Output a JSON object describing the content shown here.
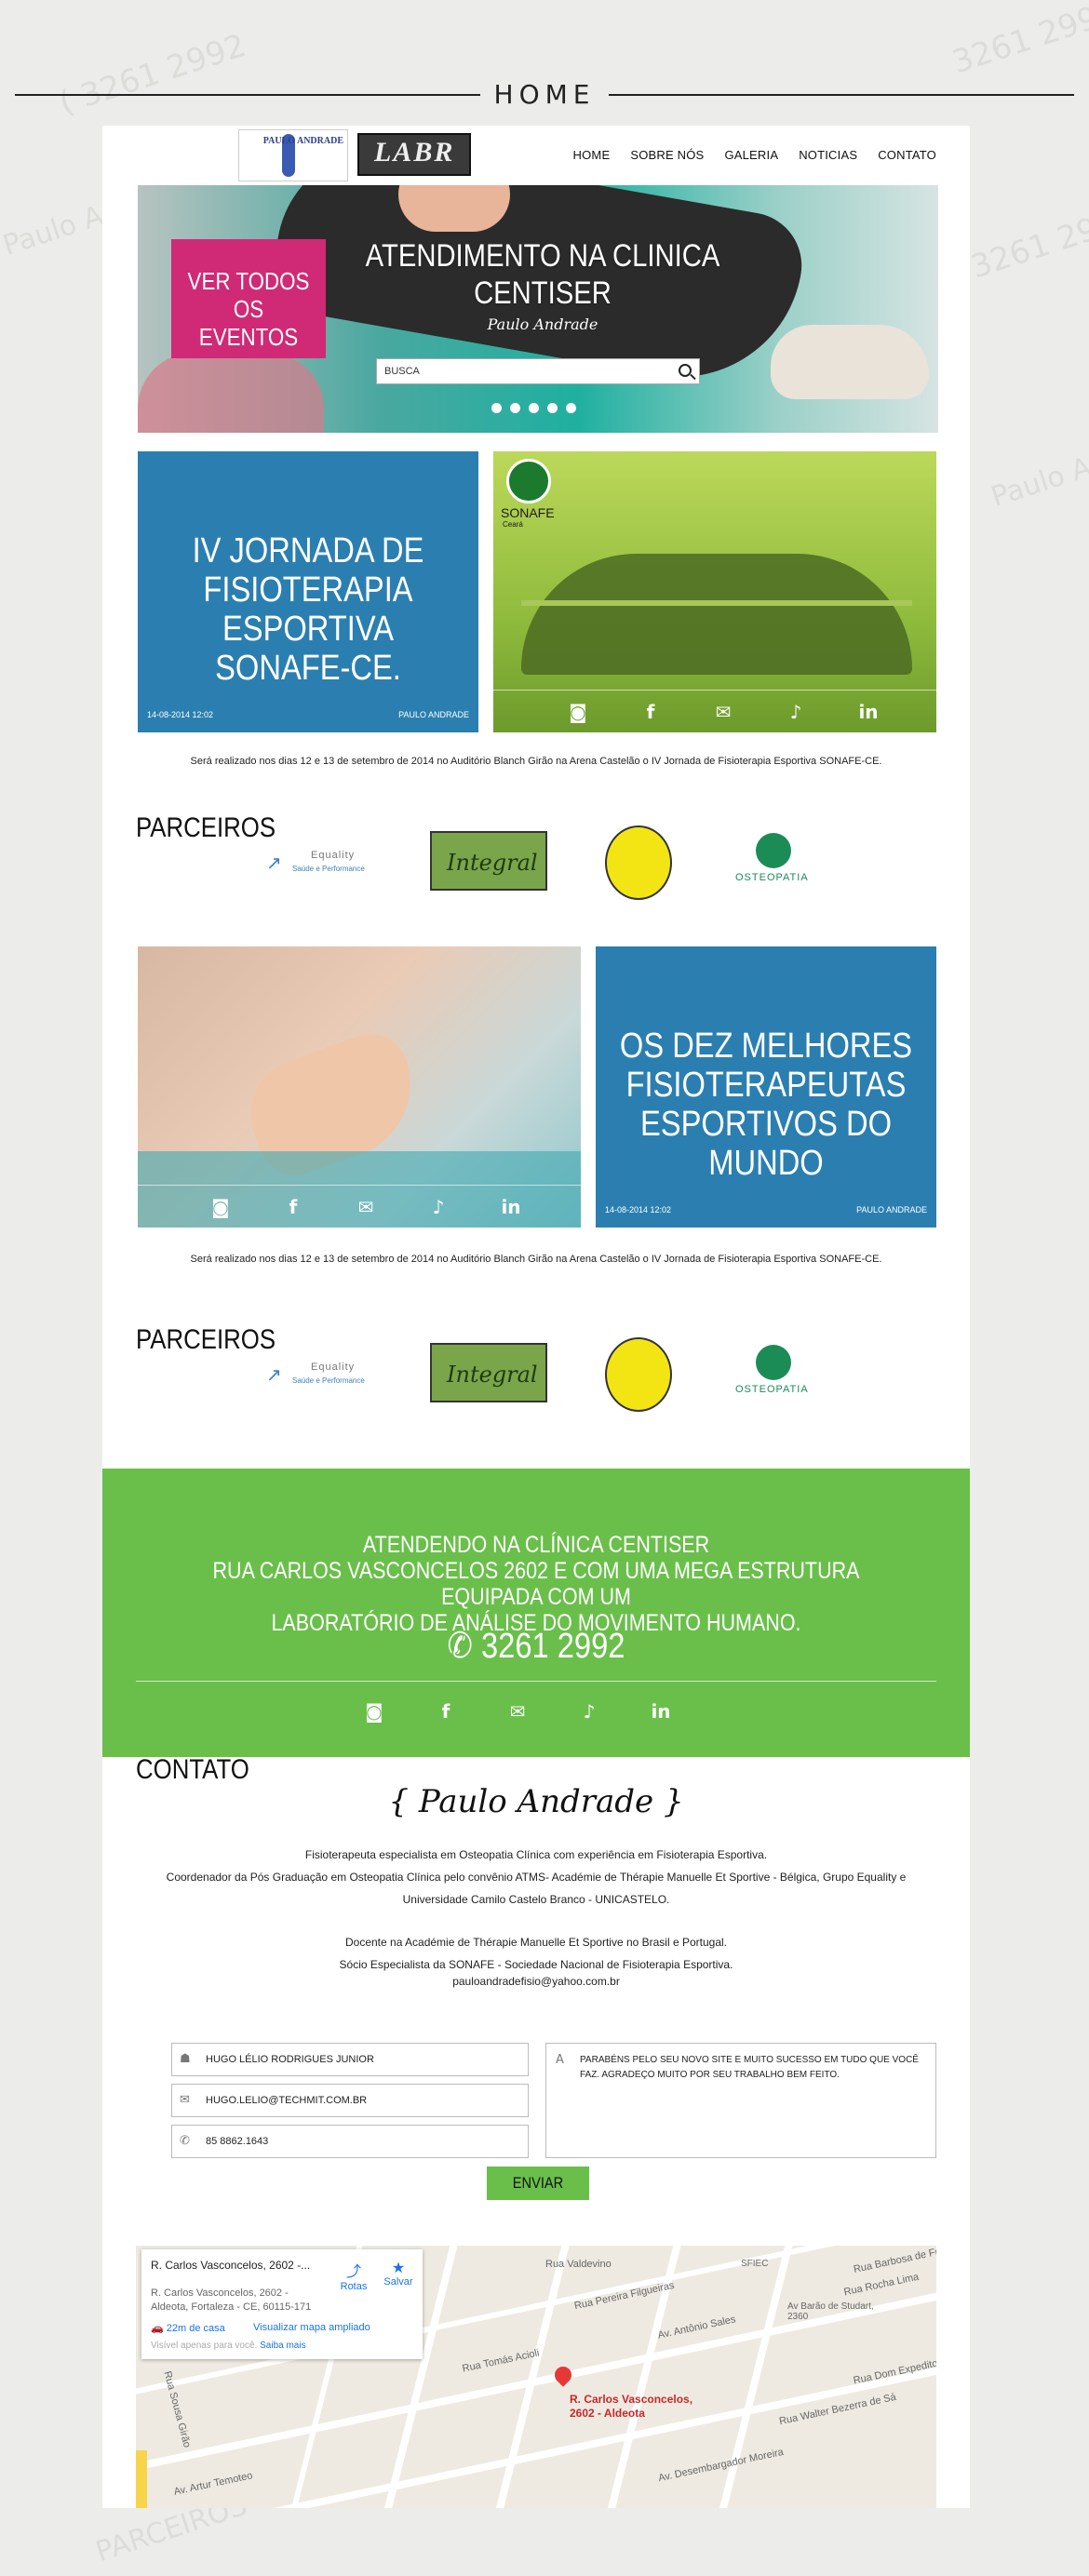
{
  "page_title": "HOME",
  "nav": {
    "items": [
      "HOME",
      "SOBRE NÓS",
      "GALERIA",
      "NOTICIAS",
      "CONTATO"
    ]
  },
  "logos": {
    "paulo": "PAULO ANDRADE",
    "labr": "LABR"
  },
  "hero": {
    "events_button": "VER TODOS OS EVENTOS",
    "title": "ATENDIMENTO NA CLINICA CENTISER",
    "signature": "Paulo Andrade",
    "search_placeholder": "BUSCA",
    "slide_count": 5
  },
  "post1": {
    "title": "IV JORNADA DE FISIOTERAPIA ESPORTIVA SONAFE-CE.",
    "date": "14-08-2014 12:02",
    "author": "PAULO ANDRADE",
    "sonafe_label": "SONAFE",
    "sonafe_sub": "Ceará",
    "caption": "Será realizado nos dias 12 e 13 de setembro de 2014 no Auditório Blanch Girão na Arena Castelão o IV Jornada de Fisioterapia Esportiva SONAFE-CE."
  },
  "post2": {
    "title": "OS DEZ MELHORES FISIOTERAPEUTAS ESPORTIVOS DO MUNDO",
    "date": "14-08-2014 12:02",
    "author": "PAULO ANDRADE",
    "caption": "Será realizado nos dias 12 e 13 de setembro de 2014 no Auditório Blanch Girão na Arena Castelão o IV Jornada de Fisioterapia Esportiva SONAFE-CE."
  },
  "parceiros": {
    "title": "PARCEIROS",
    "equality": "Equality",
    "equality_sub": "Saúde e Performance",
    "integral": "Integral",
    "osteopatia": "OSTEOPATIA"
  },
  "green": {
    "line1": "ATENDENDO NA CLÍNICA CENTISER",
    "line2": "RUA CARLOS VASCONCELOS 2602 E COM UMA MEGA ESTRUTURA EQUIPADA COM UM",
    "line3": "LABORATÓRIO DE ANÁLISE DO MOVIMENTO HUMANO.",
    "phone": "3261 2992"
  },
  "contato": {
    "title": "CONTATO",
    "signature": "{ Paulo Andrade }",
    "bio1": "Fisioterapeuta especialista em Osteopatia Clínica com experiência em Fisioterapia Esportiva.",
    "bio2": "Coordenador da Pós Graduação em Osteopatia Clínica pelo convênio ATMS- Académie de Thérapie Manuelle Et Sportive - Bélgica, Grupo Equality e",
    "bio3": "Universidade Camilo Castelo Branco - UNICASTELO.",
    "bio4": "Docente na Académie de Thérapie Manuelle Et Sportive no Brasil e Portugal.",
    "bio5": "Sócio Especialista da SONAFE - Sociedade Nacional de Fisioterapia Esportiva.",
    "email": "pauloandradefisio@yahoo.com.br"
  },
  "form": {
    "name": "HUGO LÉLIO RODRIGUES JUNIOR",
    "email": "HUGO.LELIO@TECHMIT.COM.BR",
    "phone": "85 8862.1643",
    "message": "PARABÉNS PELO SEU NOVO SITE E MUITO SUCESSO EM TUDO QUE VOCÊ FAZ. AGRADEÇO MUITO POR SEU TRABALHO BEM FEITO.",
    "submit": "ENVIAR"
  },
  "map": {
    "card_title": "R. Carlos Vasconcelos, 2602 -...",
    "card_addr1": "R. Carlos Vasconcelos, 2602 -",
    "card_addr2": "Aldeota, Fortaleza - CE, 60115-171",
    "routes": "Rotas",
    "save": "Salvar",
    "drive_time": "22m de casa",
    "larger_map": "Visualizar mapa ampliado",
    "visible_note": "Visível apenas para você.",
    "learn_more": "Saiba mais",
    "pin_label1": "R. Carlos Vasconcelos,",
    "pin_label2": "2602 - Aldeota",
    "streets": [
      "Rua Valdevino",
      "Rua Pereira Filgueiras",
      "Av. Antônio Sales",
      "Rua Tomás Acioli",
      "Av. Desembargador Moreira",
      "Rua Rocha Lima",
      "Rua Walter Bezerra de Sá",
      "Rua Dom Expedito",
      "Rua Barbosa de Freitas",
      "Rua Sousa Girão",
      "Av. Artur Temoteo"
    ],
    "poi1": "SFIEC",
    "poi2": "Av Barão de Studart, 2360"
  },
  "colors": {
    "blue": "#2b7fb0",
    "pink": "#d02a76",
    "green": "#6abf4b"
  }
}
